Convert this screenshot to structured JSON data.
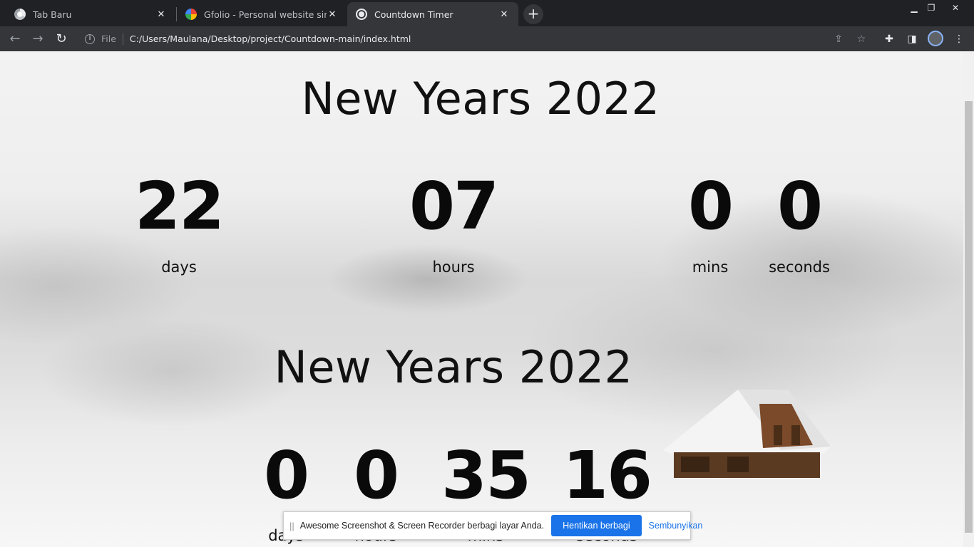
{
  "browser": {
    "tabs": [
      {
        "title": "Tab Baru",
        "active": false,
        "icon": "chrome-icon"
      },
      {
        "title": "Gfolio - Personal website simulat",
        "active": false,
        "icon": "google-icon"
      },
      {
        "title": "Countdown Timer",
        "active": true,
        "icon": "globe-icon"
      }
    ],
    "new_tab": "+",
    "window_controls": {
      "minimize": "▁",
      "restore": "❐",
      "close": "✕"
    },
    "address": {
      "scheme_label": "File",
      "url": "C:/Users/Maulana/Desktop/project/Countdown-main/index.html"
    },
    "toolbar_icons": [
      "share-icon",
      "star-icon",
      "extensions-icon",
      "side-panel-icon",
      "profile-avatar",
      "menu-icon"
    ]
  },
  "page": {
    "countdown_top": {
      "title": "New Years 2022",
      "days": "22",
      "days_label": "days",
      "hours": "07",
      "hours_label": "hours",
      "mins": "0",
      "mins_label": "mins",
      "seconds": "0",
      "seconds_label": "seconds"
    },
    "countdown_bottom": {
      "title": "New Years 2022",
      "days": "0",
      "days_label": "days",
      "hours": "0",
      "hours_label": "hours",
      "mins": "35",
      "mins_label": "mins",
      "seconds": "16",
      "seconds_label": "seconds"
    }
  },
  "share_bar": {
    "message": "Awesome Screenshot & Screen Recorder berbagi layar Anda.",
    "stop_button": "Hentikan berbagi",
    "hide_link": "Sembunyikan"
  },
  "colors": {
    "tab_strip": "#202124",
    "toolbar": "#35363a",
    "accent_blue": "#1a73e8",
    "countdown_text": "#0a0a0a"
  }
}
